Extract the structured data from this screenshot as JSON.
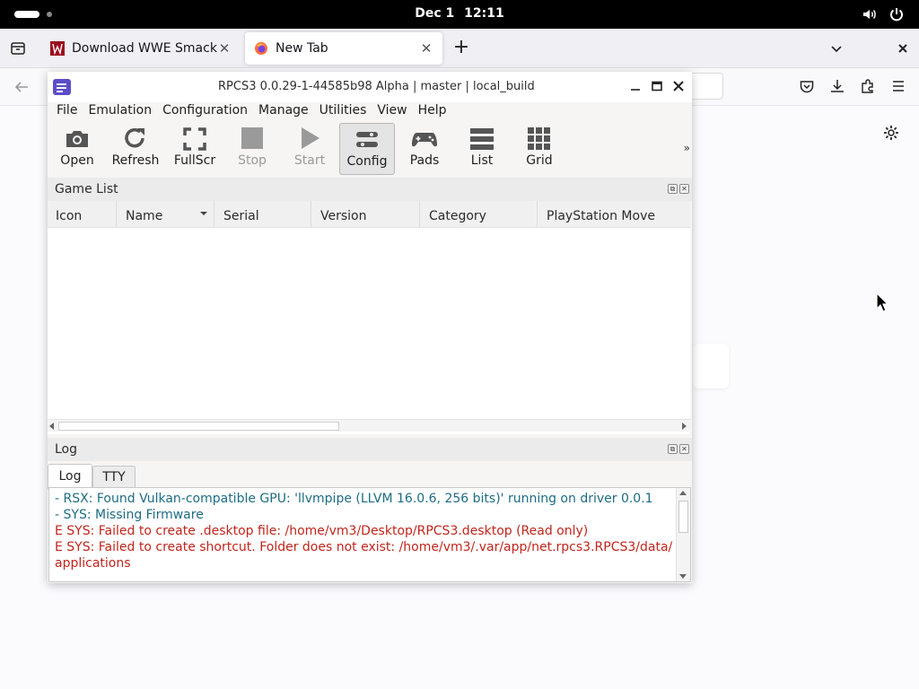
{
  "topbar": {
    "date": "Dec 1",
    "time": "12:11",
    "icons": [
      "volume-icon",
      "power-icon"
    ]
  },
  "browser": {
    "tabs": [
      {
        "title": "Download WWE SmackDown",
        "icon": "wwe-favicon",
        "active": false
      },
      {
        "title": "New Tab",
        "icon": "firefox-favicon",
        "active": true
      }
    ],
    "nav_icons": [
      "pocket-icon",
      "download-icon",
      "extensions-icon",
      "menu-icon"
    ]
  },
  "rpcs3": {
    "title": "RPCS3 0.0.29-1-44585b98 Alpha | master | local_build",
    "menu": [
      "File",
      "Emulation",
      "Configuration",
      "Manage",
      "Utilities",
      "View",
      "Help"
    ],
    "toolbar": {
      "open": "Open",
      "refresh": "Refresh",
      "fullscr": "FullScr",
      "stop": "Stop",
      "start": "Start",
      "config": "Config",
      "pads": "Pads",
      "list": "List",
      "grid": "Grid",
      "more": "»"
    },
    "game_list": {
      "title": "Game List",
      "columns": [
        "Icon",
        "Name",
        "Serial",
        "Version",
        "Category",
        "PlayStation Move"
      ]
    },
    "log": {
      "title": "Log",
      "tabs": [
        "Log",
        "TTY"
      ],
      "lines": [
        {
          "text": "- RSX: Found Vulkan-compatible GPU: 'llvmpipe (LLVM 16.0.6, 256 bits)' running on driver 0.0.1",
          "color": "#1d6c83"
        },
        {
          "text": "- SYS: Missing Firmware",
          "color": "#1d6c83"
        },
        {
          "text": "E SYS: Failed to create .desktop file: /home/vm3/Desktop/RPCS3.desktop (Read only)",
          "color": "#c0251c"
        },
        {
          "text": "E SYS: Failed to create shortcut. Folder does not exist: /home/vm3/.var/app/net.rpcs3.RPCS3/data/",
          "color": "#c0251c"
        },
        {
          "text": "applications",
          "color": "#c0251c"
        }
      ]
    }
  }
}
